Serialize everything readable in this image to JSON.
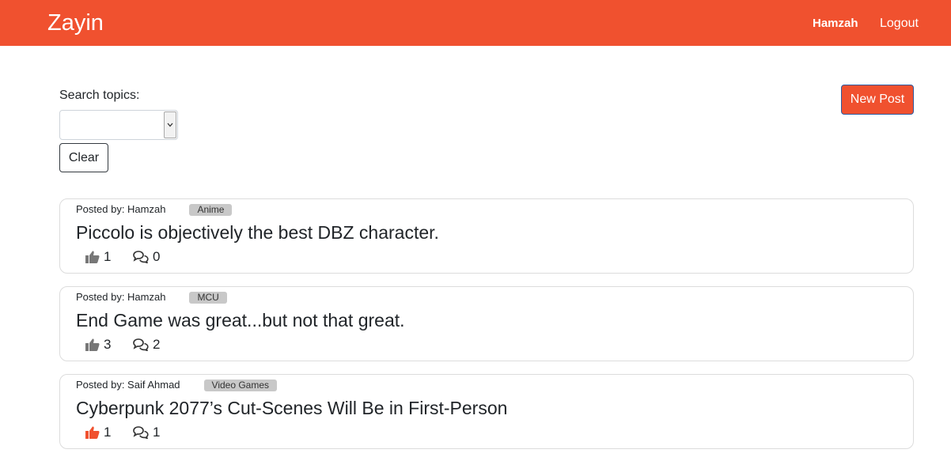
{
  "navbar": {
    "brand": "Zayin",
    "user": "Hamzah",
    "logout": "Logout",
    "background": "#f0512f"
  },
  "search": {
    "label": "Search topics:",
    "selected": "",
    "clear_label": "Clear"
  },
  "new_post_label": "New Post",
  "posts": [
    {
      "posted_by": "Posted by: Hamzah",
      "topic": "Anime",
      "title": "Piccolo is objectively the best DBZ character.",
      "likes": "1",
      "comments": "0",
      "liked": false
    },
    {
      "posted_by": "Posted by: Hamzah",
      "topic": "MCU",
      "title": "End Game was great...but not that great.",
      "likes": "3",
      "comments": "2",
      "liked": false
    },
    {
      "posted_by": "Posted by: Saif Ahmad",
      "topic": "Video Games",
      "title": "Cyberpunk 2077’s Cut-Scenes Will Be in First-Person",
      "likes": "1",
      "comments": "1",
      "liked": true
    }
  ],
  "colors": {
    "accent": "#f0512f",
    "like_inactive": "#777777",
    "like_active": "#f0512f"
  },
  "icons": {
    "like": "thumbs-up-icon",
    "comment": "comments-icon",
    "dropdown": "chevron-down-icon"
  }
}
